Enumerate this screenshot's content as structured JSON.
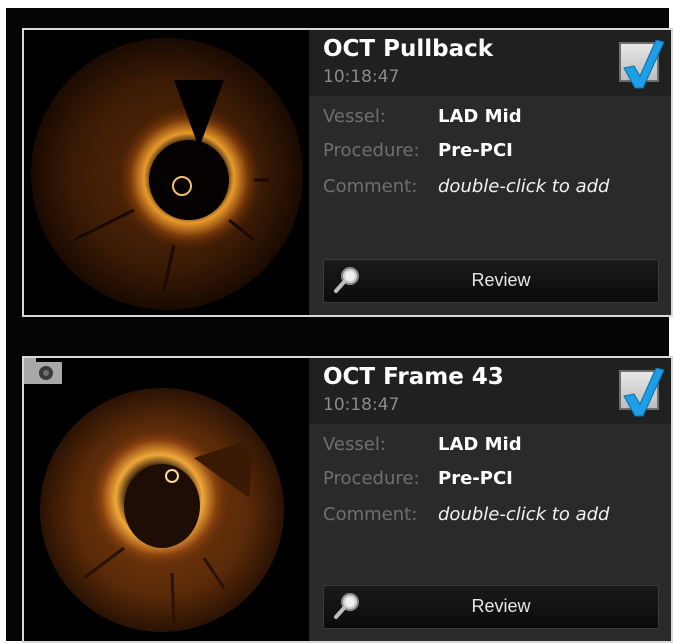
{
  "cards": [
    {
      "title": "OCT Pullback",
      "time": "10:18:47",
      "vessel_label": "Vessel:",
      "vessel_value": "LAD Mid",
      "procedure_label": "Procedure:",
      "procedure_value": "Pre-PCI",
      "comment_label": "Comment:",
      "comment_value": "double-click to add",
      "review_label": "Review",
      "checked": true
    },
    {
      "title": "OCT Frame 43",
      "time": "10:18:47",
      "vessel_label": "Vessel:",
      "vessel_value": "LAD Mid",
      "procedure_label": "Procedure:",
      "procedure_value": "Pre-PCI",
      "comment_label": "Comment:",
      "comment_value": "double-click to add",
      "review_label": "Review",
      "checked": true
    }
  ],
  "colors": {
    "check_blue": "#1e9ee6",
    "tissue_orange": "#c77a1c",
    "panel_bg": "#2a2a2a"
  },
  "icons": [
    "magnifier-icon",
    "checkmark-icon",
    "camera-icon"
  ]
}
